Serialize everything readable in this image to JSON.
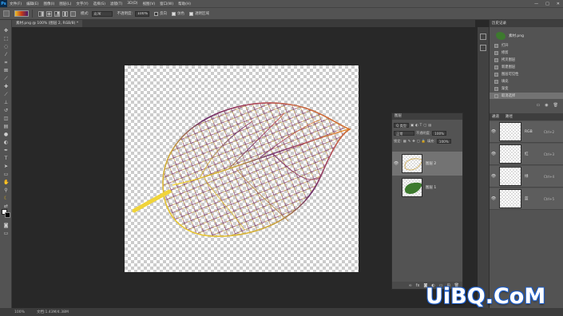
{
  "app": {
    "logo": "Ps"
  },
  "menu": [
    "文件(F)",
    "编辑(E)",
    "图像(I)",
    "图层(L)",
    "文字(Y)",
    "选择(S)",
    "滤镜(T)",
    "3D(D)",
    "视图(V)",
    "窗口(W)",
    "帮助(H)"
  ],
  "window_controls": [
    "—",
    "□",
    "✕"
  ],
  "options_bar": {
    "mode_label": "模式:",
    "mode_value": "正常",
    "opacity_label": "不透明度:",
    "opacity_value": "100%",
    "reverse_label": "反向",
    "dither_label": "仿色",
    "transparency_label": "透明区域",
    "reverse_checked": false,
    "dither_checked": true,
    "transparency_checked": true,
    "gradient_colors": [
      "#e8c02a",
      "#c33a1a",
      "#4a1a6a"
    ]
  },
  "document": {
    "tab_label": "素材.png @ 100% (图层 2, RGB/8) *"
  },
  "status": {
    "zoom": "100%",
    "doc_info": "文档:1.43M/4.38M"
  },
  "layers_panel": {
    "title": "图层",
    "kind_label": "Q 类型",
    "blend_mode": "正常",
    "opacity_label": "不透明度:",
    "opacity_value": "100%",
    "lock_label": "锁定:",
    "fill_label": "填充:",
    "fill_value": "100%",
    "layers": [
      {
        "name": "图层 2",
        "visible": true,
        "active": true,
        "thumb": "leaf-transparent"
      },
      {
        "name": "图层 1",
        "visible": false,
        "active": false,
        "thumb": "leaf-green"
      }
    ]
  },
  "history_panel": {
    "title": "历史记录",
    "snapshot": "素材.png",
    "items": [
      {
        "label": "打开",
        "active": false
      },
      {
        "label": "修剪",
        "active": false
      },
      {
        "label": "拷贝图层",
        "active": false
      },
      {
        "label": "新建图层",
        "active": false
      },
      {
        "label": "图层可见性",
        "active": false
      },
      {
        "label": "填充",
        "active": false
      },
      {
        "label": "渐变",
        "active": false
      },
      {
        "label": "取消选择",
        "active": true
      }
    ]
  },
  "channels_panel": {
    "tabs": [
      "通道",
      "路径"
    ],
    "channels": [
      {
        "name": "RGB",
        "key": "Ctrl+2"
      },
      {
        "name": "红",
        "key": "Ctrl+3"
      },
      {
        "name": "绿",
        "key": "Ctrl+4"
      },
      {
        "name": "蓝",
        "key": "Ctrl+5"
      }
    ]
  },
  "watermark": "UiBQ.CoM",
  "colors": {
    "leaf_green": "#3d7a2e",
    "accent_selected": "#737373"
  }
}
